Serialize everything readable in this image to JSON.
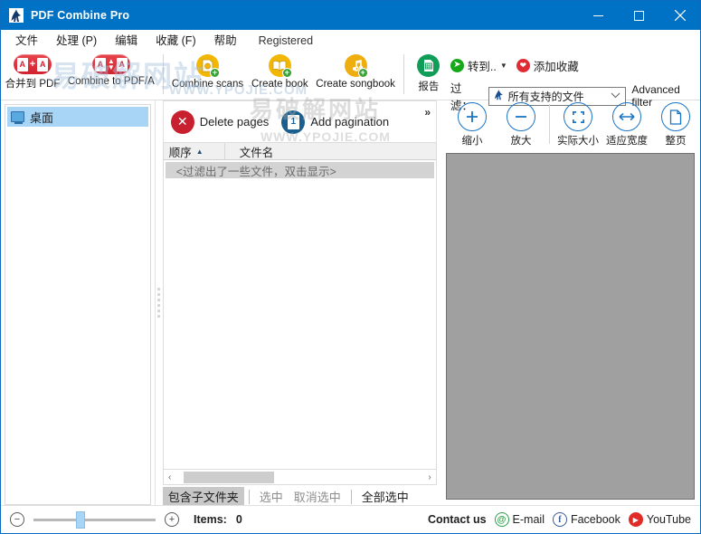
{
  "window": {
    "title": "PDF Combine Pro",
    "icon": "pdf-app-icon",
    "minimize": "–",
    "maximize": "□",
    "close": "✕"
  },
  "menu": {
    "items": [
      {
        "label": "文件",
        "name": "menu-file"
      },
      {
        "label": "处理 (P)",
        "name": "menu-process"
      },
      {
        "label": "编辑",
        "name": "menu-edit"
      },
      {
        "label": "收藏 (F)",
        "name": "menu-favorites"
      },
      {
        "label": "帮助",
        "name": "menu-help"
      },
      {
        "label": "Registered",
        "name": "menu-registered"
      }
    ]
  },
  "toolbar": {
    "buttons": [
      {
        "label": "合并到 PDF",
        "icon": "combine-to-pdf-icon"
      },
      {
        "label": "Combine to PDF/A",
        "icon": "combine-to-pdfa-icon"
      },
      {
        "label": "Combine scans",
        "icon": "combine-scans-icon"
      },
      {
        "label": "Create book",
        "icon": "create-book-icon"
      },
      {
        "label": "Create songbook",
        "icon": "create-songbook-icon"
      },
      {
        "label": "报告",
        "icon": "report-icon"
      }
    ],
    "goto_label": "转到..",
    "goto_caret": "▼",
    "add_favorite_label": "添加收藏",
    "filter_label": "过滤：",
    "filter_value": "所有支持的文件",
    "filter_chevron": "⌄",
    "advanced_filter": "Advanced filter"
  },
  "tree": {
    "items": [
      {
        "label": "桌面",
        "icon": "desktop-icon",
        "selected": true
      }
    ]
  },
  "page_toolbar": {
    "delete_pages": "Delete pages",
    "add_pagination": "Add pagination",
    "pagination_badge": "1",
    "delete_glyph": "✕",
    "overflow": "»"
  },
  "file_grid": {
    "columns": [
      {
        "label": "顺序",
        "sort": "▲"
      },
      {
        "label": "文件名",
        "sort": ""
      }
    ],
    "filter_note": "<过滤出了一些文件，双击显示>",
    "scroll_left": "‹",
    "scroll_right": "›",
    "actions": [
      {
        "label": "包含子文件夹",
        "name": "include-subfolders-button",
        "state": "pressed"
      },
      {
        "label": "选中",
        "name": "select-button",
        "state": "disabled"
      },
      {
        "label": "取消选中",
        "name": "deselect-button",
        "state": "disabled"
      },
      {
        "label": "全部选中",
        "name": "select-all-button",
        "state": "normal"
      }
    ]
  },
  "view_toolbar": {
    "buttons": [
      {
        "label": "缩小",
        "icon": "zoom-in-plus-icon",
        "glyph": "+"
      },
      {
        "label": "放大",
        "icon": "zoom-out-minus-icon",
        "glyph": "−"
      },
      {
        "label": "实际大小",
        "icon": "actual-size-icon",
        "glyph": ""
      },
      {
        "label": "适应宽度",
        "icon": "fit-width-icon",
        "glyph": "↔"
      },
      {
        "label": "整页",
        "icon": "whole-page-icon",
        "glyph": ""
      }
    ]
  },
  "status": {
    "zoom_out": "−",
    "zoom_in": "+",
    "items_label": "Items:",
    "items_value": "0",
    "contact_label": "Contact us",
    "links": [
      {
        "label": "E-mail",
        "icon": "email-icon",
        "glyph": "@"
      },
      {
        "label": "Facebook",
        "icon": "facebook-icon",
        "glyph": "f"
      },
      {
        "label": "YouTube",
        "icon": "youtube-icon",
        "glyph": "▶"
      }
    ]
  },
  "watermarks": {
    "big_cn": "易破解网站",
    "big_cn2": "易破解网站",
    "url1": "WWW.YPOJIE.COM",
    "url2": "WWW.YPOJIE.COM"
  },
  "colors": {
    "title_bar": "#0072c6",
    "accent_blue": "#1b74c4",
    "red_icon": "#d2222e",
    "green_icon": "#0f9d58",
    "yellow_icon": "#f2b705",
    "selection": "#a8d4f5",
    "preview_bg": "#a0a0a0"
  }
}
